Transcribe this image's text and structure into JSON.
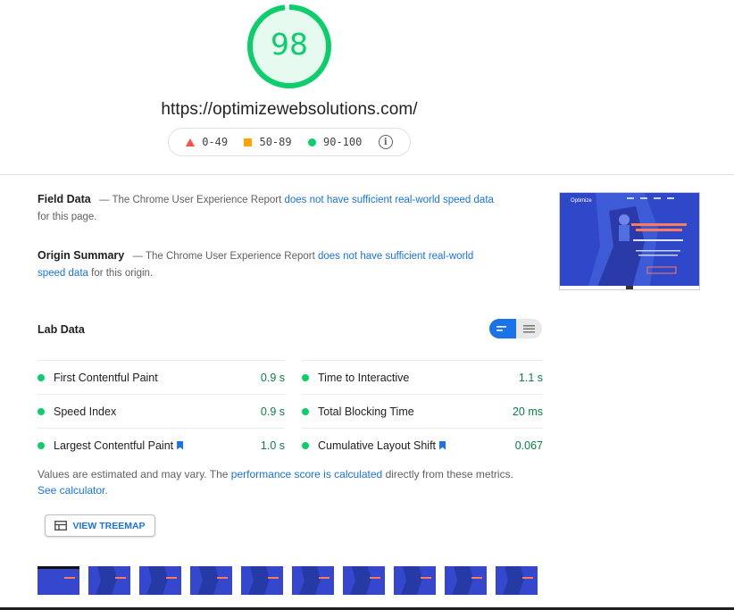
{
  "score": {
    "value": "98",
    "fraction": 0.98,
    "color": "#0cce6b"
  },
  "url": "https://optimizewebsolutions.com/",
  "legend": {
    "fail": "0-49",
    "average": "50-89",
    "pass": "90-100"
  },
  "field_data": {
    "title": "Field Data",
    "dash": "—",
    "prefix": "The Chrome User Experience Report",
    "link": "does not have sufficient real-world speed data",
    "suffix": "for this page."
  },
  "origin_summary": {
    "title": "Origin Summary",
    "dash": "—",
    "prefix": "The Chrome User Experience Report",
    "link": "does not have sufficient real-world speed data",
    "suffix": "for this origin."
  },
  "lab_data": {
    "title": "Lab Data",
    "metrics_left": [
      {
        "label": "First Contentful Paint",
        "value": "0.9 s",
        "bookmark": false
      },
      {
        "label": "Speed Index",
        "value": "0.9 s",
        "bookmark": false
      },
      {
        "label": "Largest Contentful Paint",
        "value": "1.0 s",
        "bookmark": true
      }
    ],
    "metrics_right": [
      {
        "label": "Time to Interactive",
        "value": "1.1 s",
        "bookmark": false
      },
      {
        "label": "Total Blocking Time",
        "value": "20 ms",
        "bookmark": false
      },
      {
        "label": "Cumulative Layout Shift",
        "value": "0.067",
        "bookmark": true
      }
    ]
  },
  "note": {
    "prefix": "Values are estimated and may vary. The",
    "link1": "performance score is calculated",
    "middle": "directly from these metrics.",
    "link2": "See calculator."
  },
  "treemap_button": "VIEW TREEMAP",
  "preview": {
    "brand": "Optimize"
  },
  "colors": {
    "pass": "#0cce6b",
    "average": "#ffa400",
    "fail": "#ff4e42",
    "link": "#1a73e8"
  }
}
